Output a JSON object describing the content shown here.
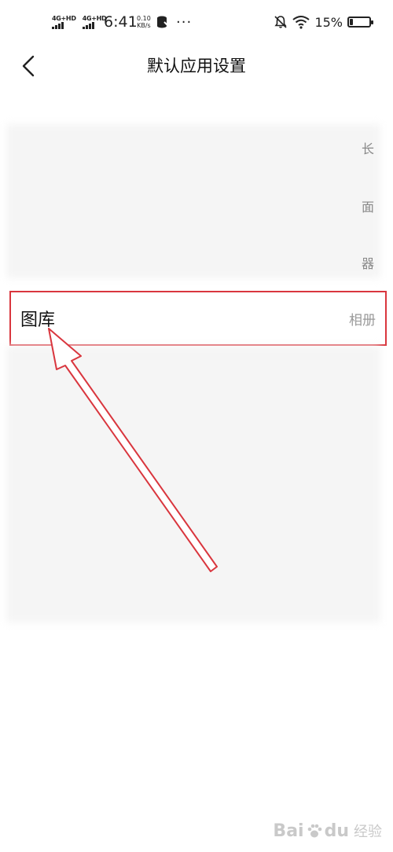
{
  "status_bar": {
    "network_1": "4G+HD",
    "network_2": "4G+HD",
    "time": "6:41",
    "speed_value": "0.10",
    "speed_unit": "KB/s",
    "more": "···",
    "battery_percent": "15%",
    "battery_level": 0.15
  },
  "header": {
    "title": "默认应用设置"
  },
  "rows_top": [
    {
      "label": "",
      "value": ""
    },
    {
      "label": "",
      "value": ""
    },
    {
      "label": "",
      "value": ""
    }
  ],
  "side_glyphs": [
    "长",
    "面",
    "器"
  ],
  "highlighted_row": {
    "label": "图库",
    "value": "相册"
  },
  "rows_bottom": [
    {
      "label": "",
      "value": ""
    },
    {
      "label": "",
      "value": ""
    },
    {
      "label": "",
      "value": ""
    },
    {
      "label": "",
      "value": ""
    },
    {
      "label": "",
      "value": ""
    }
  ],
  "annotation": {
    "color": "#d9363e"
  },
  "watermark": {
    "brand": "Bai",
    "brand_suffix": "du",
    "sub": "经验"
  }
}
